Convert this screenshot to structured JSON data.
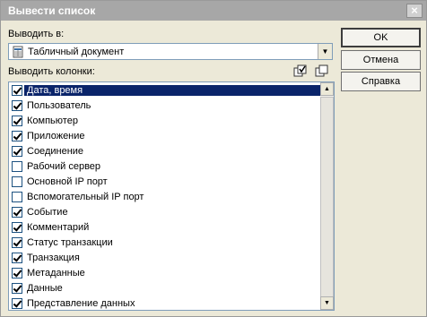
{
  "window": {
    "title": "Вывести список"
  },
  "output_to": {
    "label": "Выводить в:",
    "value": "Табличный документ"
  },
  "columns": {
    "label": "Выводить колонки:",
    "items": [
      {
        "label": "Дата, время",
        "checked": true,
        "selected": true
      },
      {
        "label": "Пользователь",
        "checked": true
      },
      {
        "label": "Компьютер",
        "checked": true
      },
      {
        "label": "Приложение",
        "checked": true
      },
      {
        "label": "Соединение",
        "checked": true
      },
      {
        "label": "Рабочий сервер",
        "checked": false
      },
      {
        "label": "Основной IP порт",
        "checked": false
      },
      {
        "label": "Вспомогательный IP порт",
        "checked": false
      },
      {
        "label": "Событие",
        "checked": true
      },
      {
        "label": "Комментарий",
        "checked": true
      },
      {
        "label": "Статус транзакции",
        "checked": true
      },
      {
        "label": "Транзакция",
        "checked": true
      },
      {
        "label": "Метаданные",
        "checked": true
      },
      {
        "label": "Данные",
        "checked": true
      },
      {
        "label": "Представление данных",
        "checked": true
      }
    ]
  },
  "buttons": {
    "ok": "OK",
    "cancel": "Отмена",
    "help": "Справка"
  },
  "icons": {
    "close": "close-icon",
    "check_all": "check-all-icon",
    "uncheck_all": "uncheck-all-icon",
    "document": "spreadsheet-document-icon"
  },
  "colors": {
    "selection": "#0a246a",
    "titlebar": "#a7a7a7"
  }
}
